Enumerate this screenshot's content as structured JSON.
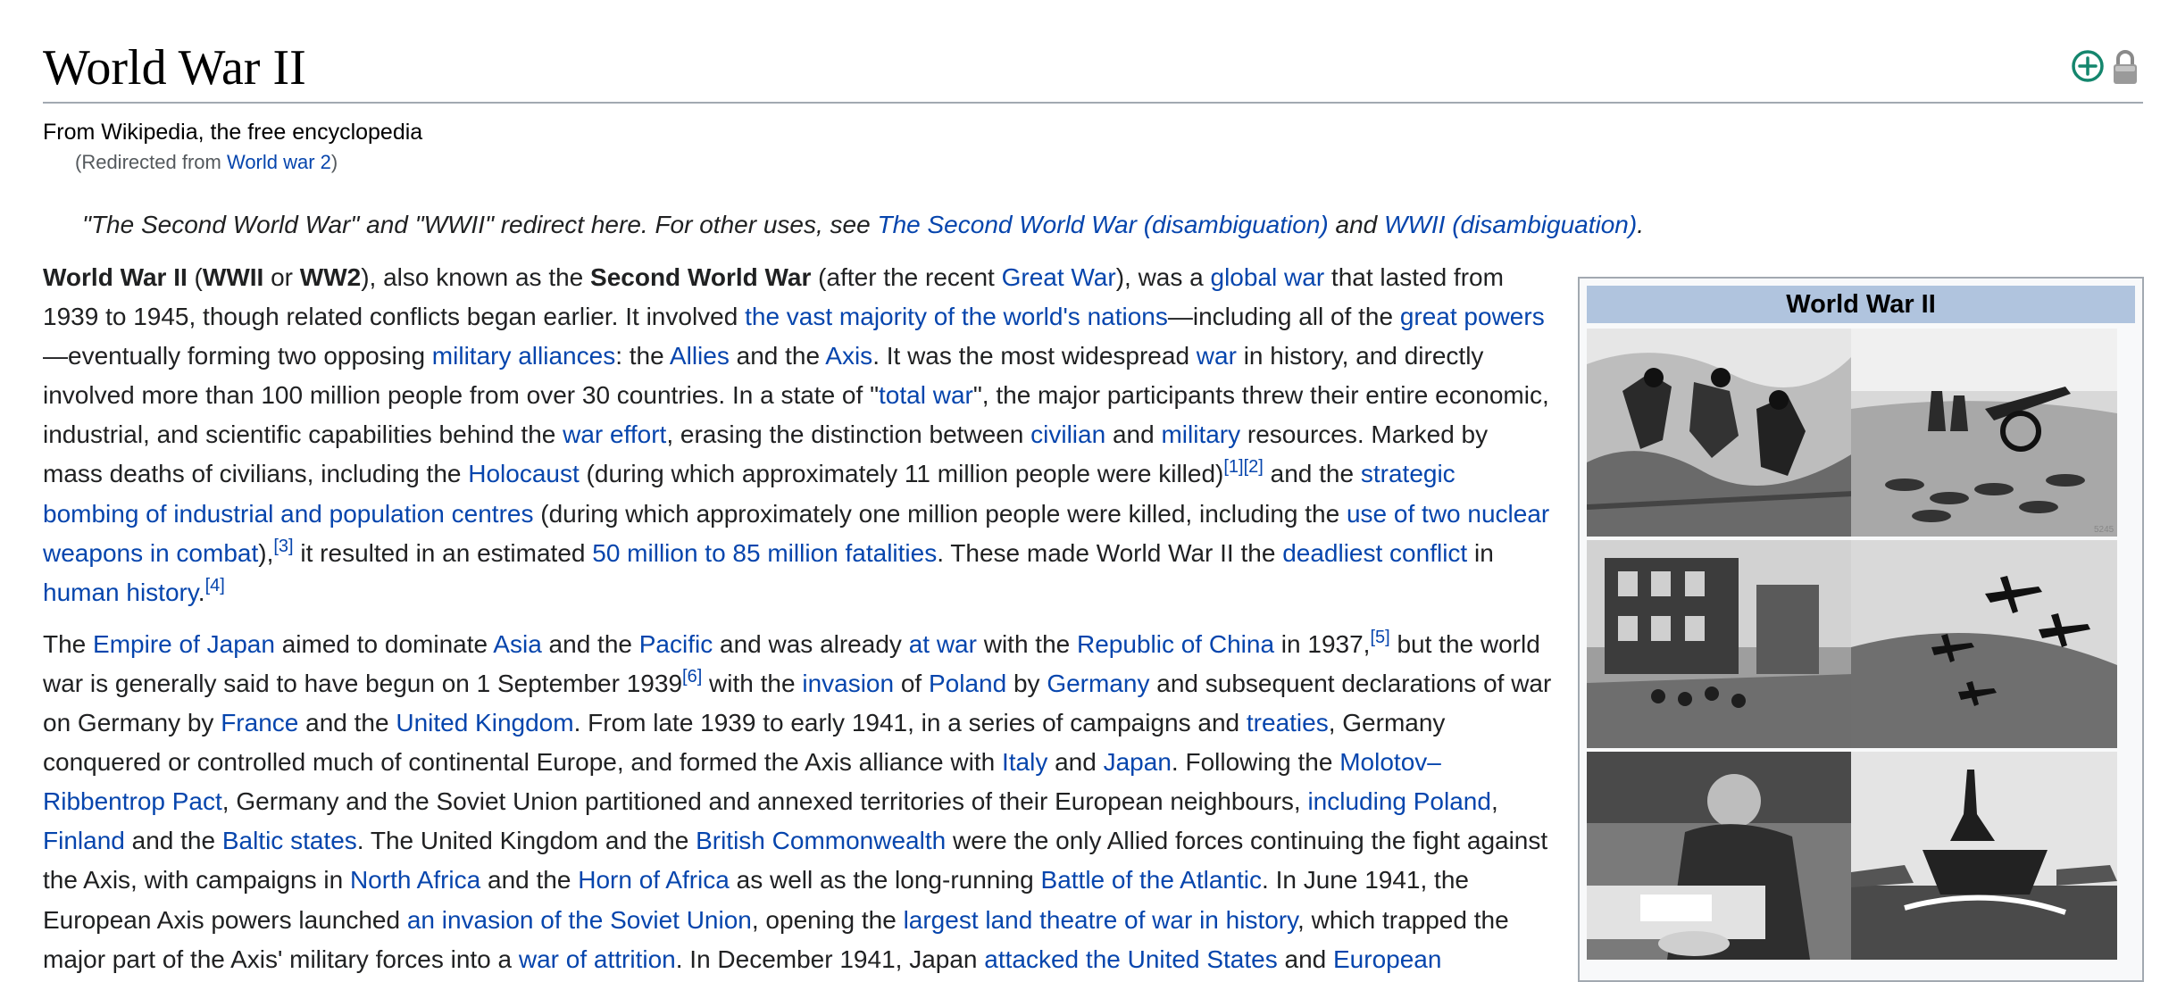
{
  "page": {
    "title": "World War II",
    "tagline": "From Wikipedia, the free encyclopedia",
    "redirect": {
      "prefix": "(Redirected from ",
      "link": "World war 2",
      "suffix": ")"
    },
    "indicators": {
      "add": "plus-circle-icon",
      "protection": "lock-icon"
    }
  },
  "hatnote": {
    "t1": "\"The Second World War\" and \"WWII\" redirect here. For other uses, see ",
    "l1": "The Second World War (disambiguation)",
    "t2": " and ",
    "l2": "WWII (disambiguation)",
    "t3": "."
  },
  "para1": [
    {
      "b": "World War II"
    },
    {
      "t": " ("
    },
    {
      "b": "WWII"
    },
    {
      "t": " or "
    },
    {
      "b": "WW2"
    },
    {
      "t": "), also known as the "
    },
    {
      "b": "Second World War"
    },
    {
      "t": " (after the recent "
    },
    {
      "l": "Great War"
    },
    {
      "t": "), was a "
    },
    {
      "l": "global war"
    },
    {
      "t": " that lasted from 1939 to 1945, though related conflicts began earlier. It involved "
    },
    {
      "l": "the vast majority of the world's nations"
    },
    {
      "t": "—including all of the "
    },
    {
      "l": "great powers"
    },
    {
      "t": "—eventually forming two opposing "
    },
    {
      "l": "military alliances"
    },
    {
      "t": ": the "
    },
    {
      "l": "Allies"
    },
    {
      "t": " and the "
    },
    {
      "l": "Axis"
    },
    {
      "t": ". It was the most widespread "
    },
    {
      "l": "war"
    },
    {
      "t": " in history, and directly involved more than 100 million people from over 30 countries. In a state of \""
    },
    {
      "l": "total war"
    },
    {
      "t": "\", the major participants threw their entire economic, industrial, and scientific capabilities behind the "
    },
    {
      "l": "war effort"
    },
    {
      "t": ", erasing the distinction between "
    },
    {
      "l": "civilian"
    },
    {
      "t": " and "
    },
    {
      "l": "military"
    },
    {
      "t": " resources. Marked by mass deaths of civilians, including the "
    },
    {
      "l": "Holocaust"
    },
    {
      "t": " (during which approximately 11 million people were killed)"
    },
    {
      "s": "[1]"
    },
    {
      "s": "[2]"
    },
    {
      "t": " and the "
    },
    {
      "l": "strategic bombing of industrial and population centres"
    },
    {
      "t": " (during which approximately one million people were killed, including the "
    },
    {
      "l": "use of two nuclear weapons in combat"
    },
    {
      "t": "),"
    },
    {
      "s": "[3]"
    },
    {
      "t": " it resulted in an estimated "
    },
    {
      "l": "50 million to 85 million fatalities"
    },
    {
      "t": ". These made World War II the "
    },
    {
      "l": "deadliest conflict"
    },
    {
      "t": " in "
    },
    {
      "l": "human history"
    },
    {
      "t": "."
    },
    {
      "s": "[4]"
    }
  ],
  "para2": [
    {
      "t": "The "
    },
    {
      "l": "Empire of Japan"
    },
    {
      "t": " aimed to dominate "
    },
    {
      "l": "Asia"
    },
    {
      "t": " and the "
    },
    {
      "l": "Pacific"
    },
    {
      "t": " and was already "
    },
    {
      "l": "at war"
    },
    {
      "t": " with the "
    },
    {
      "l": "Republic of China"
    },
    {
      "t": " in 1937,"
    },
    {
      "s": "[5]"
    },
    {
      "t": " but the world war is generally said to have begun on 1 September 1939"
    },
    {
      "s": "[6]"
    },
    {
      "t": " with the "
    },
    {
      "l": "invasion"
    },
    {
      "t": " of "
    },
    {
      "l": "Poland"
    },
    {
      "t": " by "
    },
    {
      "l": "Germany"
    },
    {
      "t": " and subsequent declarations of war on Germany by "
    },
    {
      "l": "France"
    },
    {
      "t": " and the "
    },
    {
      "l": "United Kingdom"
    },
    {
      "t": ". From late 1939 to early 1941, in a series of campaigns and "
    },
    {
      "l": "treaties"
    },
    {
      "t": ", Germany conquered or controlled much of continental Europe, and formed the Axis alliance with "
    },
    {
      "l": "Italy"
    },
    {
      "t": " and "
    },
    {
      "l": "Japan"
    },
    {
      "t": ". Following the "
    },
    {
      "l": "Molotov–Ribbentrop Pact"
    },
    {
      "t": ", Germany and the Soviet Union partitioned and annexed territories of their European neighbours, "
    },
    {
      "l": "including Poland"
    },
    {
      "t": ", "
    },
    {
      "l": "Finland"
    },
    {
      "t": " and the "
    },
    {
      "l": "Baltic states"
    },
    {
      "t": ". The United Kingdom and the "
    },
    {
      "l": "British Commonwealth"
    },
    {
      "t": " were the only Allied forces continuing the fight against the Axis, with campaigns in "
    },
    {
      "l": "North Africa"
    },
    {
      "t": " and the "
    },
    {
      "l": "Horn of Africa"
    },
    {
      "t": " as well as the long-running "
    },
    {
      "l": "Battle of the Atlantic"
    },
    {
      "t": ". In June 1941, the European Axis powers launched "
    },
    {
      "l": "an invasion of the Soviet Union"
    },
    {
      "t": ", opening the "
    },
    {
      "l": "largest land theatre of war in history"
    },
    {
      "t": ", which trapped the major part of the Axis' military forces into a "
    },
    {
      "l": "war of attrition"
    },
    {
      "t": ". In December 1941, Japan "
    },
    {
      "l": "attacked the United States"
    },
    {
      "t": " and "
    },
    {
      "l": "European"
    }
  ],
  "infobox": {
    "title": "World War II",
    "photos": [
      {
        "name": "photo-soldiers-trench"
      },
      {
        "name": "photo-artillery-desert"
      },
      {
        "name": "photo-ruined-city-battle"
      },
      {
        "name": "photo-dive-bombers-flight"
      },
      {
        "name": "photo-surrender-signing"
      },
      {
        "name": "photo-battleship-fleet"
      }
    ],
    "photo_credit": "5245"
  }
}
